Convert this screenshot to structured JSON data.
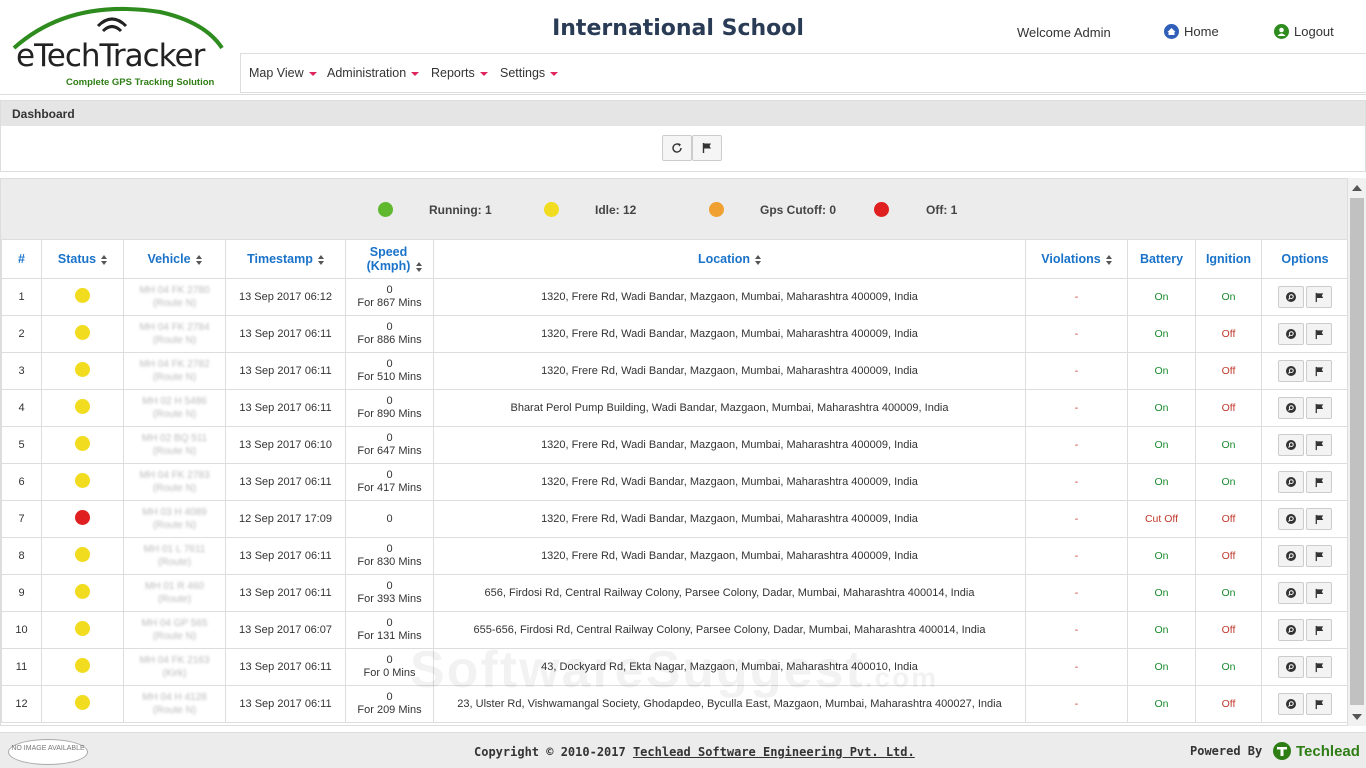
{
  "header": {
    "logo_text": "eTechTracker",
    "logo_sub": "Complete GPS Tracking Solution",
    "school_name": "International School",
    "welcome": "Welcome Admin",
    "home_label": "Home",
    "logout_label": "Logout"
  },
  "menu": [
    "Map View",
    "Administration",
    "Reports",
    "Settings"
  ],
  "dashboard": {
    "title": "Dashboard"
  },
  "summary": {
    "running": "Running: 1",
    "idle": "Idle: 12",
    "gps_cutoff": "Gps Cutoff: 0",
    "off": "Off: 1"
  },
  "colors": {
    "running": "#5fb82e",
    "idle": "#f1dc1f",
    "gps_cutoff": "#f0a030",
    "off": "#e02020",
    "accent": "#1a73c9"
  },
  "table": {
    "headers": [
      "#",
      "Status",
      "Vehicle",
      "Timestamp",
      "Speed (Kmph)",
      "Location",
      "Violations",
      "Battery",
      "Ignition",
      "Options"
    ],
    "rows": [
      {
        "n": "1",
        "status": "idle",
        "vehicle": "MH 04 FK 2780",
        "route": "(Route N)",
        "time": "13 Sep 2017 06:12",
        "speed": "0",
        "dur": "For 867 Mins",
        "loc": "1320, Frere Rd, Wadi Bandar, Mazgaon, Mumbai, Maharashtra 400009, India",
        "viol": "-",
        "battery": "On",
        "ignition": "On"
      },
      {
        "n": "2",
        "status": "idle",
        "vehicle": "MH 04 FK 2784",
        "route": "(Route N)",
        "time": "13 Sep 2017 06:11",
        "speed": "0",
        "dur": "For 886 Mins",
        "loc": "1320, Frere Rd, Wadi Bandar, Mazgaon, Mumbai, Maharashtra 400009, India",
        "viol": "-",
        "battery": "On",
        "ignition": "Off"
      },
      {
        "n": "3",
        "status": "idle",
        "vehicle": "MH 04 FK 2782",
        "route": "(Route N)",
        "time": "13 Sep 2017 06:11",
        "speed": "0",
        "dur": "For 510 Mins",
        "loc": "1320, Frere Rd, Wadi Bandar, Mazgaon, Mumbai, Maharashtra 400009, India",
        "viol": "-",
        "battery": "On",
        "ignition": "Off"
      },
      {
        "n": "4",
        "status": "idle",
        "vehicle": "MH 02 H 5486",
        "route": "(Route N)",
        "time": "13 Sep 2017 06:11",
        "speed": "0",
        "dur": "For 890 Mins",
        "loc": "Bharat Perol Pump Building, Wadi Bandar, Mazgaon, Mumbai, Maharashtra 400009, India",
        "viol": "-",
        "battery": "On",
        "ignition": "Off"
      },
      {
        "n": "5",
        "status": "idle",
        "vehicle": "MH 02 BQ 511",
        "route": "(Route N)",
        "time": "13 Sep 2017 06:10",
        "speed": "0",
        "dur": "For 647 Mins",
        "loc": "1320, Frere Rd, Wadi Bandar, Mazgaon, Mumbai, Maharashtra 400009, India",
        "viol": "-",
        "battery": "On",
        "ignition": "On"
      },
      {
        "n": "6",
        "status": "idle",
        "vehicle": "MH 04 FK 2783",
        "route": "(Route N)",
        "time": "13 Sep 2017 06:11",
        "speed": "0",
        "dur": "For 417 Mins",
        "loc": "1320, Frere Rd, Wadi Bandar, Mazgaon, Mumbai, Maharashtra 400009, India",
        "viol": "-",
        "battery": "On",
        "ignition": "On"
      },
      {
        "n": "7",
        "status": "off",
        "vehicle": "MH 03 H 4089",
        "route": "(Route N)",
        "time": "12 Sep 2017 17:09",
        "speed": "0",
        "dur": "",
        "loc": "1320, Frere Rd, Wadi Bandar, Mazgaon, Mumbai, Maharashtra 400009, India",
        "viol": "-",
        "battery": "Cut Off",
        "ignition": "Off"
      },
      {
        "n": "8",
        "status": "idle",
        "vehicle": "MH 01 L 7611",
        "route": "(Route)",
        "time": "13 Sep 2017 06:11",
        "speed": "0",
        "dur": "For 830 Mins",
        "loc": "1320, Frere Rd, Wadi Bandar, Mazgaon, Mumbai, Maharashtra 400009, India",
        "viol": "-",
        "battery": "On",
        "ignition": "Off"
      },
      {
        "n": "9",
        "status": "idle",
        "vehicle": "MH 01 R 460",
        "route": "(Route)",
        "time": "13 Sep 2017 06:11",
        "speed": "0",
        "dur": "For 393 Mins",
        "loc": "656, Firdosi Rd, Central Railway Colony, Parsee Colony, Dadar, Mumbai, Maharashtra 400014, India",
        "viol": "-",
        "battery": "On",
        "ignition": "On"
      },
      {
        "n": "10",
        "status": "idle",
        "vehicle": "MH 04 GP 565",
        "route": "(Route N)",
        "time": "13 Sep 2017 06:07",
        "speed": "0",
        "dur": "For 131 Mins",
        "loc": "655-656, Firdosi Rd, Central Railway Colony, Parsee Colony, Dadar, Mumbai, Maharashtra 400014, India",
        "viol": "-",
        "battery": "On",
        "ignition": "Off"
      },
      {
        "n": "11",
        "status": "idle",
        "vehicle": "MH 04 FK 2163",
        "route": "(Kirk)",
        "time": "13 Sep 2017 06:11",
        "speed": "0",
        "dur": "For 0 Mins",
        "loc": "43, Dockyard Rd, Ekta Nagar, Mazgaon, Mumbai, Maharashtra 400010, India",
        "viol": "-",
        "battery": "On",
        "ignition": "On"
      },
      {
        "n": "12",
        "status": "idle",
        "vehicle": "MH 04 H 4128",
        "route": "(Route N)",
        "time": "13 Sep 2017 06:11",
        "speed": "0",
        "dur": "For 209 Mins",
        "loc": "23, Ulster Rd, Vishwamangal Society, Ghodapdeo, Byculla East, Mazgaon, Mumbai, Maharashtra 400027, India",
        "viol": "-",
        "battery": "On",
        "ignition": "Off"
      }
    ]
  },
  "footer": {
    "noimage": "NO IMAGE AVAILABLE",
    "copyright_prefix": "Copyright © 2010-2017 ",
    "copyright_company": "Techlead Software Engineering Pvt. Ltd.",
    "powered_by": "Powered By",
    "brand": "Techlead"
  },
  "watermark": {
    "main": "SoftwareSuggest",
    "suffix": ".com"
  }
}
